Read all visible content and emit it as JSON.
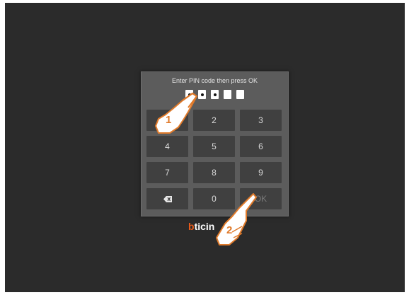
{
  "prompt_text": "Enter PIN code then press OK",
  "pin": {
    "length": 5,
    "filled": 3
  },
  "keypad": [
    {
      "label": "",
      "name": "key-1"
    },
    {
      "label": "2",
      "name": "key-2"
    },
    {
      "label": "3",
      "name": "key-3"
    },
    {
      "label": "4",
      "name": "key-4"
    },
    {
      "label": "5",
      "name": "key-5"
    },
    {
      "label": "6",
      "name": "key-6"
    },
    {
      "label": "7",
      "name": "key-7"
    },
    {
      "label": "8",
      "name": "key-8"
    },
    {
      "label": "9",
      "name": "key-9"
    },
    {
      "label": "",
      "name": "backspace-key",
      "icon": "backspace-icon"
    },
    {
      "label": "0",
      "name": "key-0"
    },
    {
      "label": "OK",
      "name": "ok-key"
    }
  ],
  "logo": {
    "first": "b",
    "rest": "ticin"
  },
  "callouts": {
    "step1": "1",
    "step2": "2"
  },
  "colors": {
    "screen_bg": "#2b2b2b",
    "panel_bg": "#5c5c5c",
    "key_bg": "#404040",
    "callout": "#e07a2a",
    "logo_b": "#e85a1a"
  }
}
